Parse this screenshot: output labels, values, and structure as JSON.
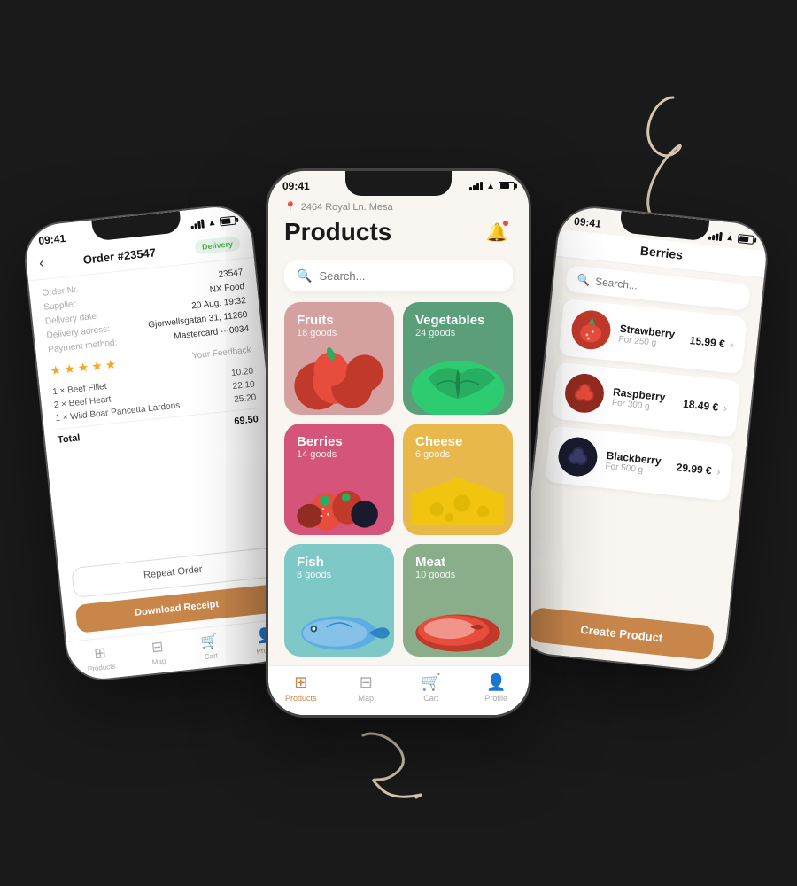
{
  "scene": {
    "background": "#1a1a1a"
  },
  "centerPhone": {
    "statusBar": {
      "time": "09:41",
      "signal": "full",
      "wifi": true,
      "battery": 70
    },
    "location": "2464 Royal Ln. Mesa",
    "title": "Products",
    "search": {
      "placeholder": "Search..."
    },
    "categories": [
      {
        "id": "fruits",
        "name": "Fruits",
        "count": "18 goods",
        "color": "#d4a0a0"
      },
      {
        "id": "vegetables",
        "name": "Vegetables",
        "count": "24 goods",
        "color": "#5a9e7a"
      },
      {
        "id": "berries",
        "name": "Berries",
        "count": "14 goods",
        "color": "#d4547a"
      },
      {
        "id": "cheese",
        "name": "Cheese",
        "count": "6 goods",
        "color": "#e8b84b"
      },
      {
        "id": "fish",
        "name": "Fish",
        "count": "8 goods",
        "color": "#7ec8c8"
      },
      {
        "id": "meat",
        "name": "Meat",
        "count": "10 goods",
        "color": "#8aad8a"
      }
    ],
    "nav": [
      {
        "id": "products",
        "label": "Products",
        "active": true
      },
      {
        "id": "map",
        "label": "Map",
        "active": false
      },
      {
        "id": "cart",
        "label": "Cart",
        "active": false
      },
      {
        "id": "profile",
        "label": "Profile",
        "active": false
      }
    ]
  },
  "leftPhone": {
    "statusBar": {
      "time": "09:41"
    },
    "header": {
      "orderNumber": "Order #23547",
      "badge": "Delivery"
    },
    "details": [
      {
        "label": "Order Nr.",
        "value": "23547"
      },
      {
        "label": "Supplier",
        "value": "NX Food"
      },
      {
        "label": "Delivery date",
        "value": "20 Aug, 19:32"
      },
      {
        "label": "Delivery adress:",
        "value": "Gjorwellsgatan 31, 11260"
      },
      {
        "label": "Payment method:",
        "value": "Mastercard ···0034"
      }
    ],
    "rating": 5,
    "feedbackLabel": "Your Feedback",
    "items": [
      {
        "qty": "1 × Beef Fillet",
        "price": "10.20"
      },
      {
        "qty": "2 × Beef Heart",
        "price": "22.10"
      },
      {
        "qty": "1 × Wild Boar Pancetta Lardons",
        "price": "25.20"
      }
    ],
    "total": {
      "label": "Total",
      "value": "69.50"
    },
    "buttons": {
      "repeat": "Repeat Order",
      "download": "Download Receipt"
    },
    "nav": [
      {
        "id": "products",
        "label": "Products",
        "active": false
      },
      {
        "id": "map",
        "label": "Map",
        "active": false
      },
      {
        "id": "cart",
        "label": "Cart",
        "active": false
      },
      {
        "id": "profile",
        "label": "Profile",
        "active": true
      }
    ]
  },
  "rightPhone": {
    "statusBar": {
      "time": "09:41"
    },
    "header": "Berries",
    "search": {
      "placeholder": "Search..."
    },
    "items": [
      {
        "name": "Strawberry",
        "weight": "For 250 g",
        "price": "15.99 €"
      },
      {
        "name": "Raspberry",
        "weight": "For 300 g",
        "price": "18.49 €"
      },
      {
        "name": "Blackberry",
        "weight": "For 500 g",
        "price": "29.99 €"
      }
    ],
    "createButton": "Create Product"
  }
}
